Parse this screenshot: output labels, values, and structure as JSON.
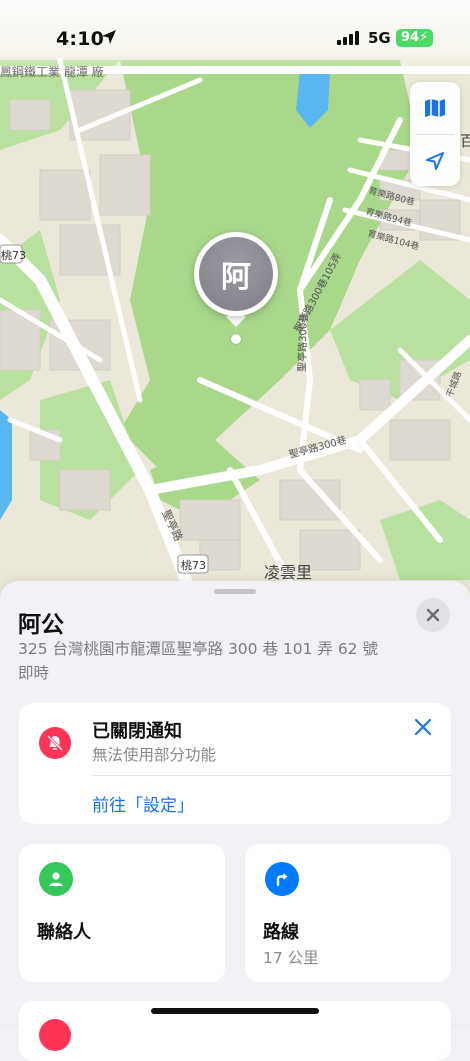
{
  "status_bar": {
    "time": "4:10",
    "network": "5G",
    "battery": "94"
  },
  "map": {
    "labels": {
      "top_road": "鳳鋼鐵工業 龍潭 廠",
      "road_taoyuan73_a": "桃73",
      "road_taoyuan73_b": "桃73",
      "road_lane300_105": "聖亭路300巷105弄",
      "road_lane300": "聖亭路300巷",
      "road_shengting": "聖亭路",
      "road_yule80": "育樂路80巷",
      "road_yule94": "育樂路94巷",
      "road_yule104": "育樂路104巷",
      "road_ganyuan": "干城路",
      "district": "凌雲里",
      "edge_char": "百"
    },
    "colors": {
      "park": "#a9d88b",
      "land": "#ece8d9",
      "road": "#ffffff",
      "water": "#5ab6f0"
    }
  },
  "pin": {
    "initial": "阿"
  },
  "sheet": {
    "name": "阿公",
    "address": "325 台灣桃園市龍潭區聖亭路 300 巷 101 弄 62 號",
    "updated": "即時",
    "notification": {
      "title": "已關閉通知",
      "subtitle": "無法使用部分功能",
      "link": "前往「設定」"
    },
    "actions": [
      {
        "label": "聯絡人",
        "sub": "",
        "color": "#34c759",
        "icon": "person-icon"
      },
      {
        "label": "路線",
        "sub": "17 公里",
        "color": "#007aff",
        "icon": "directions-arrow-icon"
      }
    ],
    "accent": "#1a73e8",
    "alert_color": "#ff3558"
  }
}
